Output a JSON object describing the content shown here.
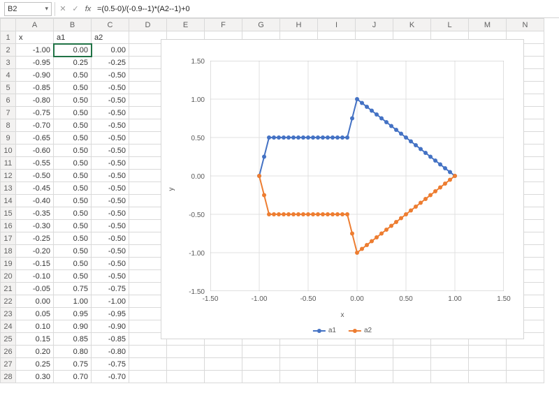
{
  "formula_bar": {
    "cell_ref": "B2",
    "formula": "=(0.5-0)/(-0.9--1)*(A2--1)+0"
  },
  "columns": [
    "",
    "A",
    "B",
    "C",
    "D",
    "E",
    "F",
    "G",
    "H",
    "I",
    "J",
    "K",
    "L",
    "M",
    "N"
  ],
  "headers": {
    "A": "x",
    "B": "a1",
    "C": "a2"
  },
  "rows": [
    {
      "n": 1,
      "A": "x",
      "B": "a1",
      "C": "a2",
      "hdr": true
    },
    {
      "n": 2,
      "A": "-1.00",
      "B": "0.00",
      "C": "0.00"
    },
    {
      "n": 3,
      "A": "-0.95",
      "B": "0.25",
      "C": "-0.25"
    },
    {
      "n": 4,
      "A": "-0.90",
      "B": "0.50",
      "C": "-0.50"
    },
    {
      "n": 5,
      "A": "-0.85",
      "B": "0.50",
      "C": "-0.50"
    },
    {
      "n": 6,
      "A": "-0.80",
      "B": "0.50",
      "C": "-0.50"
    },
    {
      "n": 7,
      "A": "-0.75",
      "B": "0.50",
      "C": "-0.50"
    },
    {
      "n": 8,
      "A": "-0.70",
      "B": "0.50",
      "C": "-0.50"
    },
    {
      "n": 9,
      "A": "-0.65",
      "B": "0.50",
      "C": "-0.50"
    },
    {
      "n": 10,
      "A": "-0.60",
      "B": "0.50",
      "C": "-0.50"
    },
    {
      "n": 11,
      "A": "-0.55",
      "B": "0.50",
      "C": "-0.50"
    },
    {
      "n": 12,
      "A": "-0.50",
      "B": "0.50",
      "C": "-0.50"
    },
    {
      "n": 13,
      "A": "-0.45",
      "B": "0.50",
      "C": "-0.50"
    },
    {
      "n": 14,
      "A": "-0.40",
      "B": "0.50",
      "C": "-0.50"
    },
    {
      "n": 15,
      "A": "-0.35",
      "B": "0.50",
      "C": "-0.50"
    },
    {
      "n": 16,
      "A": "-0.30",
      "B": "0.50",
      "C": "-0.50"
    },
    {
      "n": 17,
      "A": "-0.25",
      "B": "0.50",
      "C": "-0.50"
    },
    {
      "n": 18,
      "A": "-0.20",
      "B": "0.50",
      "C": "-0.50"
    },
    {
      "n": 19,
      "A": "-0.15",
      "B": "0.50",
      "C": "-0.50"
    },
    {
      "n": 20,
      "A": "-0.10",
      "B": "0.50",
      "C": "-0.50"
    },
    {
      "n": 21,
      "A": "-0.05",
      "B": "0.75",
      "C": "-0.75"
    },
    {
      "n": 22,
      "A": "0.00",
      "B": "1.00",
      "C": "-1.00"
    },
    {
      "n": 23,
      "A": "0.05",
      "B": "0.95",
      "C": "-0.95"
    },
    {
      "n": 24,
      "A": "0.10",
      "B": "0.90",
      "C": "-0.90"
    },
    {
      "n": 25,
      "A": "0.15",
      "B": "0.85",
      "C": "-0.85"
    },
    {
      "n": 26,
      "A": "0.20",
      "B": "0.80",
      "C": "-0.80"
    },
    {
      "n": 27,
      "A": "0.25",
      "B": "0.75",
      "C": "-0.75"
    },
    {
      "n": 28,
      "A": "0.30",
      "B": "0.70",
      "C": "-0.70"
    }
  ],
  "chart_data": {
    "type": "line",
    "title": "",
    "xlabel": "x",
    "ylabel": "y",
    "xlim": [
      -1.5,
      1.5
    ],
    "ylim": [
      -1.5,
      1.5
    ],
    "xticks": [
      -1.5,
      -1.0,
      -0.5,
      0.0,
      0.5,
      1.0,
      1.5
    ],
    "yticks": [
      -1.5,
      -1.0,
      -0.5,
      0.0,
      0.5,
      1.0,
      1.5
    ],
    "x": [
      -1.0,
      -0.95,
      -0.9,
      -0.85,
      -0.8,
      -0.75,
      -0.7,
      -0.65,
      -0.6,
      -0.55,
      -0.5,
      -0.45,
      -0.4,
      -0.35,
      -0.3,
      -0.25,
      -0.2,
      -0.15,
      -0.1,
      -0.05,
      0.0,
      0.05,
      0.1,
      0.15,
      0.2,
      0.25,
      0.3,
      0.35,
      0.4,
      0.45,
      0.5,
      0.55,
      0.6,
      0.65,
      0.7,
      0.75,
      0.8,
      0.85,
      0.9,
      0.95,
      1.0
    ],
    "series": [
      {
        "name": "a1",
        "color": "#4472C4",
        "values": [
          0.0,
          0.25,
          0.5,
          0.5,
          0.5,
          0.5,
          0.5,
          0.5,
          0.5,
          0.5,
          0.5,
          0.5,
          0.5,
          0.5,
          0.5,
          0.5,
          0.5,
          0.5,
          0.5,
          0.75,
          1.0,
          0.95,
          0.9,
          0.85,
          0.8,
          0.75,
          0.7,
          0.65,
          0.6,
          0.55,
          0.5,
          0.45,
          0.4,
          0.35,
          0.3,
          0.25,
          0.2,
          0.15,
          0.1,
          0.05,
          0.0
        ]
      },
      {
        "name": "a2",
        "color": "#ED7D31",
        "values": [
          0.0,
          -0.25,
          -0.5,
          -0.5,
          -0.5,
          -0.5,
          -0.5,
          -0.5,
          -0.5,
          -0.5,
          -0.5,
          -0.5,
          -0.5,
          -0.5,
          -0.5,
          -0.5,
          -0.5,
          -0.5,
          -0.5,
          -0.75,
          -1.0,
          -0.95,
          -0.9,
          -0.85,
          -0.8,
          -0.75,
          -0.7,
          -0.65,
          -0.6,
          -0.55,
          -0.5,
          -0.45,
          -0.4,
          -0.35,
          -0.3,
          -0.25,
          -0.2,
          -0.15,
          -0.1,
          -0.05,
          0.0
        ]
      }
    ],
    "legend_position": "bottom"
  }
}
